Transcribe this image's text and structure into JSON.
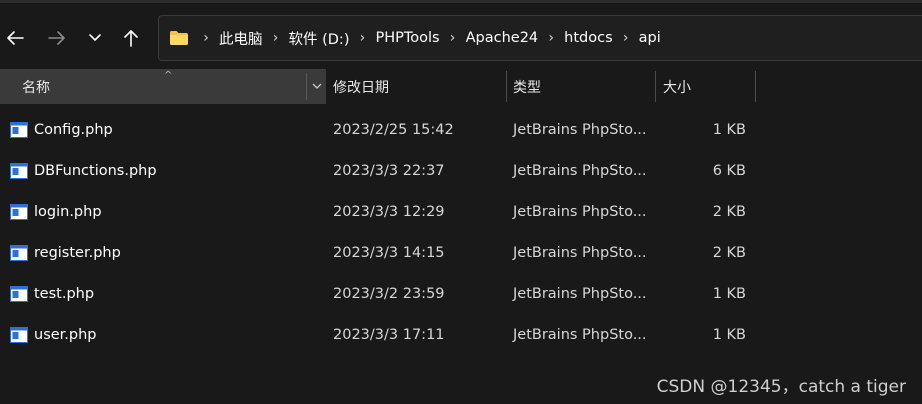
{
  "toolbar": {
    "back_icon": "arrow-left-icon",
    "forward_icon": "arrow-right-icon",
    "recent_icon": "chevron-down-icon",
    "up_icon": "arrow-up-icon"
  },
  "address": {
    "icon": "folder-icon",
    "crumbs": [
      "此电脑",
      "软件 (D:)",
      "PHPTools",
      "Apache24",
      "htdocs",
      "api"
    ]
  },
  "columns": {
    "name": "名称",
    "date": "修改日期",
    "type": "类型",
    "size": "大小"
  },
  "files": [
    {
      "name": "Config.php",
      "date": "2023/2/25 15:42",
      "type": "JetBrains PhpSto...",
      "size": "1 KB"
    },
    {
      "name": "DBFunctions.php",
      "date": "2023/3/3 22:37",
      "type": "JetBrains PhpSto...",
      "size": "6 KB"
    },
    {
      "name": "login.php",
      "date": "2023/3/3 12:29",
      "type": "JetBrains PhpSto...",
      "size": "2 KB"
    },
    {
      "name": "register.php",
      "date": "2023/3/3 14:15",
      "type": "JetBrains PhpSto...",
      "size": "2 KB"
    },
    {
      "name": "test.php",
      "date": "2023/3/2 23:59",
      "type": "JetBrains PhpSto...",
      "size": "1 KB"
    },
    {
      "name": "user.php",
      "date": "2023/3/3 17:11",
      "type": "JetBrains PhpSto...",
      "size": "1 KB"
    }
  ],
  "watermark": "CSDN @12345，catch a tiger",
  "colors": {
    "background": "#191919",
    "header_active": "#3a3a3a",
    "folder": "#f5c242",
    "file_icon_blue": "#2f6fd6"
  }
}
